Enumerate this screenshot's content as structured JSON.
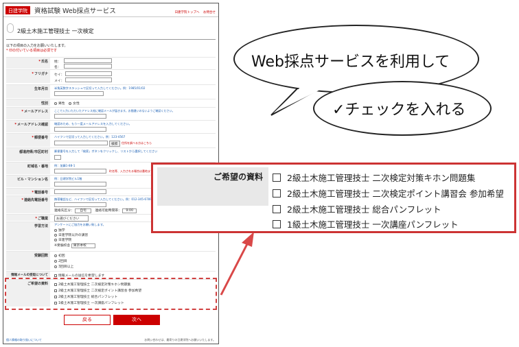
{
  "header": {
    "logo": "日建学院",
    "title": "資格試験 Web採点サービス",
    "links": [
      "日建学院トップへ",
      "お問合せ"
    ]
  },
  "page": {
    "title": "2級土木施工管理技士 一次検定",
    "intro": "以下の項目の入力をお願いいたします。",
    "required_note": "* 印の付いている項目は必須です"
  },
  "form": {
    "name": {
      "label": "氏名",
      "sei": "姓：",
      "mei": "名："
    },
    "furigana": {
      "label": "フリガナ",
      "sei": "セイ：",
      "mei": "メイ："
    },
    "birthday": {
      "label": "生年月日",
      "hint": "半角英数字スラッシュで区切って入力してください。例：1985/01/02"
    },
    "gender": {
      "label": "性別",
      "options": [
        "男性",
        "女性"
      ]
    },
    "email": {
      "label": "メールアドレス",
      "hint": "ここで入力いただいたアドレス宛に確認メールが届きます。お間違いのないようご確認ください。"
    },
    "email_confirm": {
      "label": "メールアドレス確認",
      "hint": "確認のため、もう一度メールアドレスを入力してください。"
    },
    "zip": {
      "label": "郵便番号",
      "hint": "ハイフンで区切って入力してください。例：123-4567",
      "button": "検索",
      "link": "住所を調べる方はこちら"
    },
    "prefecture": {
      "label": "都道府県/市区町村",
      "hint": "郵便番号を入力して「検索」ボタンをクリックし、リストから選択してください"
    },
    "address": {
      "label": "町域名・番地",
      "example": "例：加藤1-88-1",
      "hint": "町名等、入力される場合は番地までご入力ください。"
    },
    "building": {
      "label": "ビル・マンション名",
      "example": "例：日建学院ビル1階"
    },
    "phone": {
      "label": "電話番号"
    },
    "contact": {
      "label": "連絡先電話番号",
      "hint": "携帯電話など、ハイフンで区切って入力してください。例：012-345-6789",
      "type_label": "連絡先区分：",
      "type_value": "自宅",
      "time_label": "連絡可能時間帯：",
      "time_value": "9:00"
    },
    "job": {
      "label": "ご職業",
      "value": "お選びください"
    },
    "school": {
      "label": "学習方法",
      "hint": "アンケートにご協力をお願い致します。",
      "options": [
        "独学",
        "日建学院以外の講習",
        "日建学院"
      ],
      "exam_label": "※受験校舎",
      "exam_value": "東京本校"
    },
    "count": {
      "label": "受験回数",
      "options": [
        "初回",
        "2回目",
        "3回目以上"
      ]
    },
    "mail": {
      "label": "情報メールの受取について",
      "option": "情報メールの送信を希望します"
    },
    "materials": {
      "label": "ご希望の資料",
      "items": [
        "2級土木施工管理技士 二次検定対策キホン問題集",
        "2級土木施工管理技士 二次検定ポイント講習会 参加希望",
        "2級土木施工管理技士 総合パンフレット",
        "1級土木施工管理技士 一次講座パンフレット"
      ]
    }
  },
  "buttons": {
    "back": "戻る",
    "next": "次へ"
  },
  "footer": {
    "privacy": "個人情報の取り扱いについて",
    "note": "お問い合わせは、最寄りの日建学院へお願いいたします。"
  },
  "callout": {
    "line1": "Web採点サービスを利用して",
    "line2": "✓チェックを入れる"
  },
  "colors": {
    "accent": "#cc0000",
    "highlight": "#cc3333"
  }
}
